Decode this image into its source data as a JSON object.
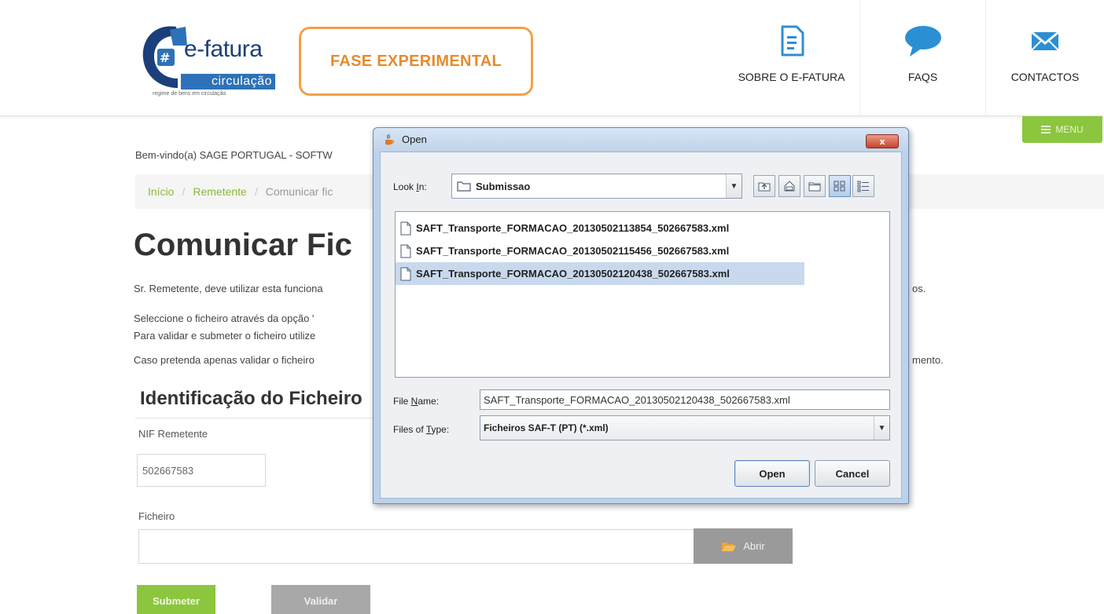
{
  "header": {
    "logo": {
      "brand": "e-fatura",
      "subbrand": "circulação",
      "tagline": "regime de bens em circulação"
    },
    "badge": "FASE EXPERIMENTAL",
    "nav": [
      {
        "label": "SOBRE O E-FATURA",
        "icon": "document-icon"
      },
      {
        "label": "FAQS",
        "icon": "speech-bubble-icon"
      },
      {
        "label": "CONTACTOS",
        "icon": "envelope-icon"
      }
    ],
    "menu_label": "MENU",
    "colors": {
      "accent_green": "#8bc63e",
      "badge_orange": "#e88a2c",
      "nav_blue": "#2b8fd4"
    }
  },
  "page": {
    "welcome": "Bem-vindo(a) SAGE PORTUGAL - SOFTW",
    "breadcrumb": [
      "Início",
      "Remetente",
      "Comunicar fic"
    ],
    "title": "Comunicar Fic",
    "paragraphs": [
      "Sr. Remetente, deve utilizar esta funciona",
      "Seleccione o ficheiro através da opção '",
      "Para validar e submeter o ficheiro utilize",
      "Caso pretenda apenas validar o ficheiro"
    ],
    "paragraph_tails": [
      "os.",
      "mento."
    ],
    "section_title": "Identificação do Ficheiro",
    "nif_label": "NIF Remetente",
    "nif_value": "502667583",
    "file_label": "Ficheiro",
    "file_value": "",
    "abrir_label": "Abrir",
    "submeter_label": "Submeter",
    "validar_label": "Validar"
  },
  "dialog": {
    "title": "Open",
    "close_label": "x",
    "look_in_label": "Look In:",
    "look_in_value": "Submissao",
    "files": [
      {
        "name": "SAFT_Transporte_FORMACAO_20130502113854_502667583.xml",
        "selected": false
      },
      {
        "name": "SAFT_Transporte_FORMACAO_20130502115456_502667583.xml",
        "selected": false
      },
      {
        "name": "SAFT_Transporte_FORMACAO_20130502120438_502667583.xml",
        "selected": true
      }
    ],
    "file_name_label": "File Name:",
    "file_name_value": "SAFT_Transporte_FORMACAO_20130502120438_502667583.xml",
    "files_of_type_label": "Files of Type:",
    "files_of_type_value": "Ficheiros SAF-T (PT) (*.xml)",
    "open_label": "Open",
    "cancel_label": "Cancel",
    "toolbar": [
      "up-folder-icon",
      "home-icon",
      "new-folder-icon",
      "list-view-icon",
      "details-view-icon"
    ]
  }
}
